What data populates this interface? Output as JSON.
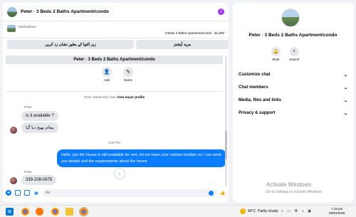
{
  "chat": {
    "header_title": "Peter · 3 Beds 2 Baths Apartment/condo",
    "info_icon": "info-icon",
    "marketplace_label": "Marketplace",
    "listing": "3 Beds 2 Baths Apartment/condo · $1,300",
    "action_left": "زیر التوا کے بطور نشان زد کریں",
    "action_right": "مزید آپشنز",
    "thread_title": "Peter · 3 Beds 2 Baths Apartment/condo",
    "add_label": "Add",
    "name_label": "Name",
    "started_text": "Peter started this chat.",
    "view_profile": "View buyer profile",
    "sender1": "Peter",
    "msg1": "Is it available ?",
    "msg2": "پیغام بھیج دیا گیا",
    "time": "6:20 PM",
    "msg_out": "Hello, yes the house is still available for rent, let me have your contact number so I can send you details and the requirements about the house",
    "sender2": "Peter",
    "msg3": "339-208-0675",
    "input_placeholder": "Aa"
  },
  "info": {
    "title": "Peter · 3 Beds 2 Baths Apartment/condo",
    "mute_label": "Mute",
    "search_label": "Search",
    "menu": [
      "Customize chat",
      "Chat members",
      "Media, files and links",
      "Privacy & support"
    ]
  },
  "watermark": {
    "line1": "Activate Windows",
    "line2": "Go to Settings to activate Windows."
  },
  "taskbar": {
    "weather_temp": "40°C",
    "weather_text": "Partly cloudy",
    "time": "7:18 pm",
    "date": "09/04/2025"
  },
  "colors": {
    "accent": "#0a7cff",
    "info_badge": "#a033ff"
  }
}
